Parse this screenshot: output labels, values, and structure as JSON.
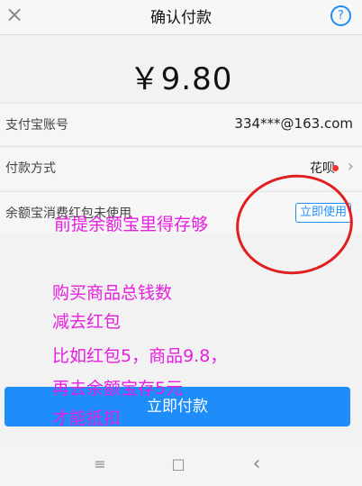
{
  "header": {
    "title": "确认付款",
    "close_icon": "×",
    "help_icon": "?"
  },
  "amount": "￥9.80",
  "rows": {
    "account": {
      "label": "支付宝账号",
      "value": "334***@163.com"
    },
    "payment_method": {
      "label": "付款方式",
      "value": "花呗"
    },
    "coupon": {
      "label": "余额宝消费红包未使用",
      "button": "立即使用"
    }
  },
  "pay_button": "立即付款",
  "annotations": [
    "前提余额宝里得存够",
    "购买商品总钱数",
    "减去红包",
    "比如红包5，商品9.8，",
    "再去余额宝存5元",
    "才能抵扣"
  ],
  "navbar": {
    "menu_icon": "≡",
    "home_icon": "□",
    "back_icon": "‹"
  },
  "colors": {
    "accent": "#1e8dfa",
    "annotation": "#e61ee0",
    "circle": "#e02020",
    "dot": "#e33"
  }
}
